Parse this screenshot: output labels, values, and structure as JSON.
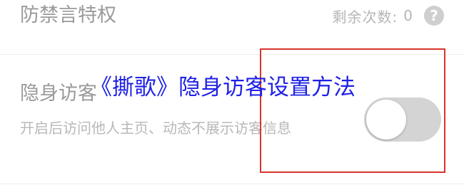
{
  "privilege_row": {
    "title": "防禁言特权",
    "remaining_label": "剩余次数:",
    "remaining_count": "0",
    "help_icon": "?"
  },
  "stealth_row": {
    "title": "隐身访客",
    "description": "开启后访问他人主页、动态不展示访客信息",
    "toggle_state": "off"
  },
  "overlay": {
    "title": "《撕歌》隐身访客设置方法"
  },
  "colors": {
    "highlight": "#d9342b",
    "overlay_text": "#1f21e6",
    "toggle_track": "#d4d4d4"
  }
}
